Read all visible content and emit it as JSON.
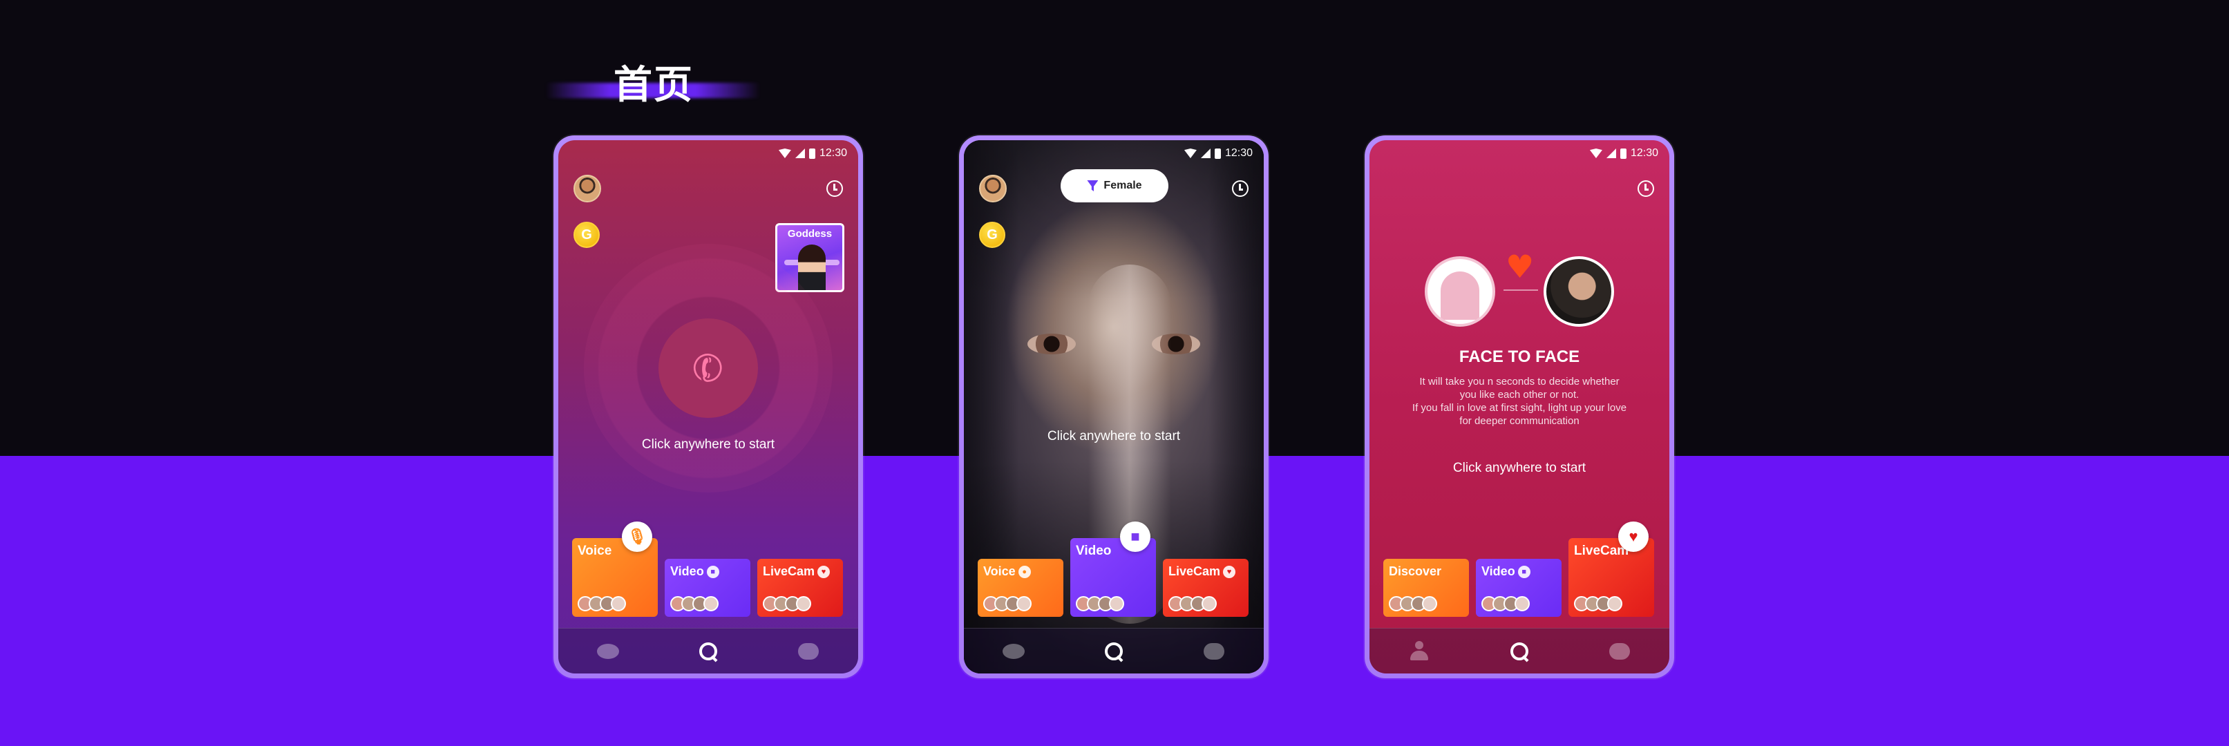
{
  "heading": "首页",
  "status_time": "12:30",
  "cta": "Click anywhere to start",
  "coin_symbol": "G",
  "phone1": {
    "goddess_label": "Goddess",
    "cards": [
      {
        "label": "Voice",
        "icon": "microphone-icon"
      },
      {
        "label": "Video",
        "icon": "camera-icon"
      },
      {
        "label": "LiveCam",
        "icon": "heart-icon"
      }
    ]
  },
  "phone2": {
    "filter_label": "Female",
    "cards": [
      {
        "label": "Voice",
        "icon": "microphone-icon"
      },
      {
        "label": "Video",
        "icon": "camera-icon"
      },
      {
        "label": "LiveCam",
        "icon": "heart-icon"
      }
    ]
  },
  "phone3": {
    "title": "FACE TO FACE",
    "description": [
      "It will take you n seconds to decide whether",
      "you like each other or not.",
      "If you fall in love at first sight, light up your love",
      "for deeper communication"
    ],
    "cards": [
      {
        "label": "Discover",
        "icon": "compass-icon"
      },
      {
        "label": "Video",
        "icon": "camera-icon"
      },
      {
        "label": "LiveCam",
        "icon": "heart-icon"
      }
    ]
  },
  "colors": {
    "accent": "#6a14f6",
    "frame": "#a77af7"
  }
}
